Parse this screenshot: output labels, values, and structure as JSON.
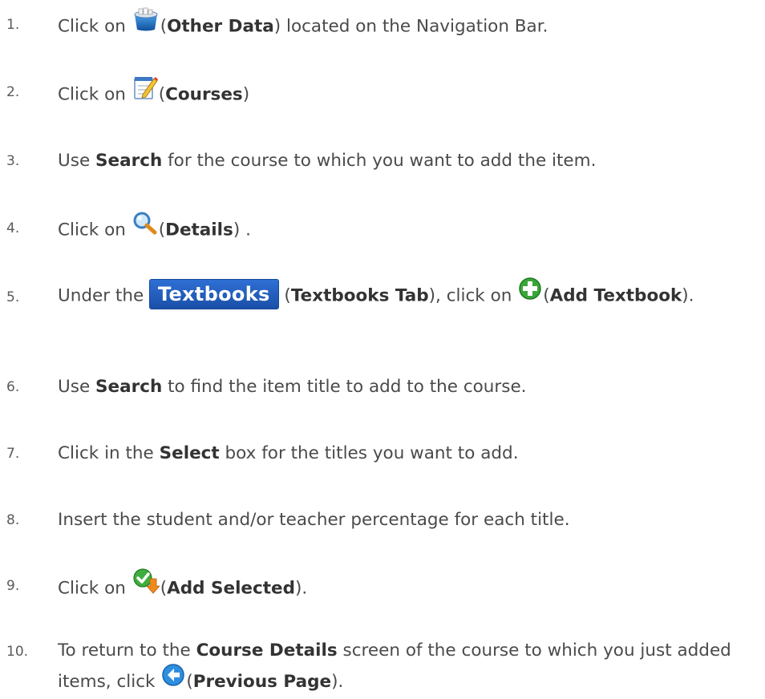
{
  "steps": [
    {
      "num": "1.",
      "pre": "Click on",
      "bold": "Other Data",
      "post": ") located on the Navigation Bar."
    },
    {
      "num": "2.",
      "pre": "Click on",
      "bold": "Courses",
      "post": ")"
    },
    {
      "num": "3.",
      "pre": "Use",
      "bold": "Search",
      "post": "for the course to which you want to add the item."
    },
    {
      "num": "4.",
      "pre": "Click on",
      "bold": "Details",
      "post": ") ."
    },
    {
      "num": "5.",
      "pre": "Under the",
      "tab": "Textbooks",
      "bold": "Textbooks Tab",
      "mid": "), click on",
      "bold2": "Add Textbook",
      "post": ")."
    },
    {
      "num": "6.",
      "pre": "Use",
      "bold": "Search",
      "post": "to find the item title to add to the course."
    },
    {
      "num": "7.",
      "pre": "Click in the",
      "bold": "Select",
      "post": "box for the titles you want to add."
    },
    {
      "num": "8.",
      "text": "Insert the student and/or teacher percentage for each title."
    },
    {
      "num": "9.",
      "pre": "Click on",
      "bold": "Add Selected",
      "post": ")."
    },
    {
      "num": "10.",
      "pre": "To return to the",
      "bold": "Course Details",
      "mid": "screen of the course to which you just added items, click",
      "bold2": "Previous Page",
      "post": ")."
    }
  ],
  "icons": {
    "step1": "other-data-icon",
    "step2": "courses-notepad-icon",
    "step4": "magnifier-details-icon",
    "step5": "add-green-plus-icon",
    "step9": "add-selected-check-icon",
    "step10": "previous-page-arrow-icon"
  }
}
